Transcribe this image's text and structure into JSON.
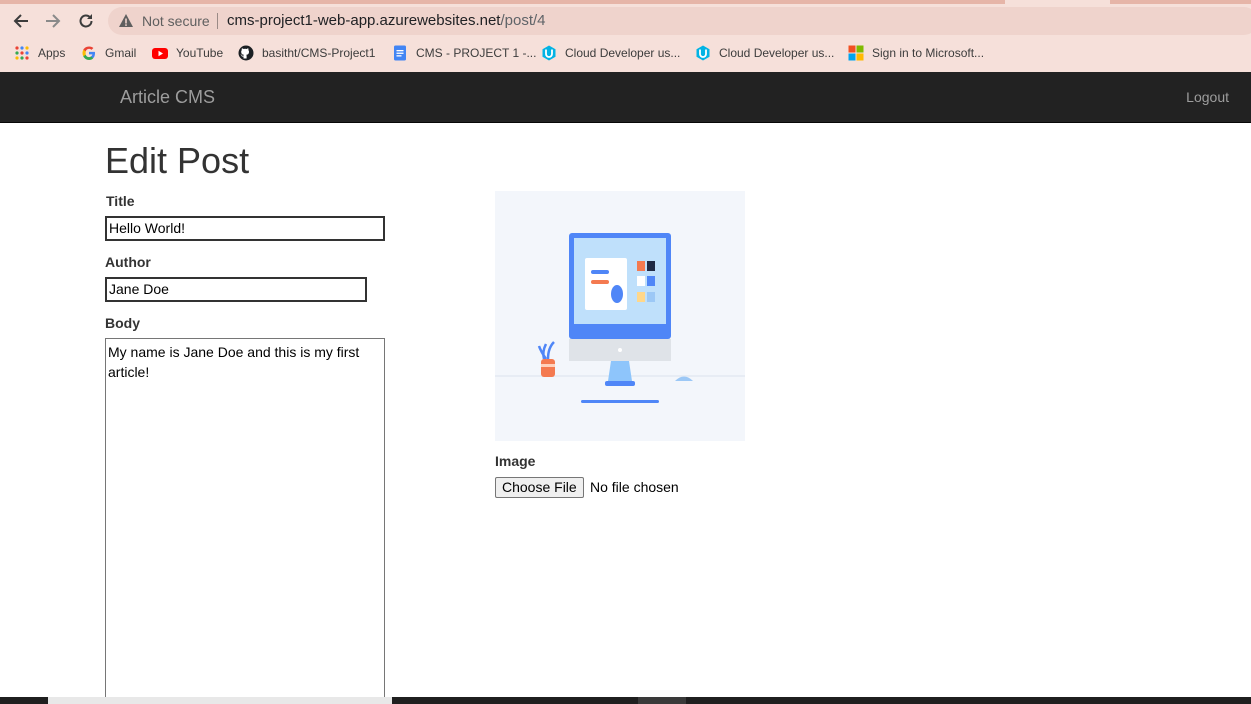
{
  "browser": {
    "security_label": "Not secure",
    "url_host": "cms-project1-web-app.azurewebsites.net",
    "url_path": "/post/4",
    "bookmarks": [
      {
        "label": "Apps",
        "icon": "apps-grid-icon"
      },
      {
        "label": "Gmail",
        "icon": "google-g-icon"
      },
      {
        "label": "YouTube",
        "icon": "youtube-icon"
      },
      {
        "label": "basitht/CMS-Project1",
        "icon": "github-icon"
      },
      {
        "label": "CMS - PROJECT 1 -...",
        "icon": "google-docs-icon"
      },
      {
        "label": "Cloud Developer us...",
        "icon": "udacity-icon"
      },
      {
        "label": "Cloud Developer us...",
        "icon": "udacity-icon"
      },
      {
        "label": "Sign in to Microsoft...",
        "icon": "microsoft-icon"
      }
    ]
  },
  "navbar": {
    "brand": "Article CMS",
    "logout": "Logout"
  },
  "form": {
    "heading": "Edit Post",
    "title_label": "Title",
    "title_value": "Hello World!",
    "author_label": "Author",
    "author_value": "Jane Doe",
    "body_label": "Body",
    "body_value": "My name is Jane Doe and this is my first article!",
    "image_label": "Image",
    "choose_file": "Choose File",
    "file_status": "No file chosen"
  },
  "colors": {
    "chrome_bg": "#f6e0da",
    "navbar_bg": "#222222",
    "accent_blue": "#4f86f7"
  }
}
